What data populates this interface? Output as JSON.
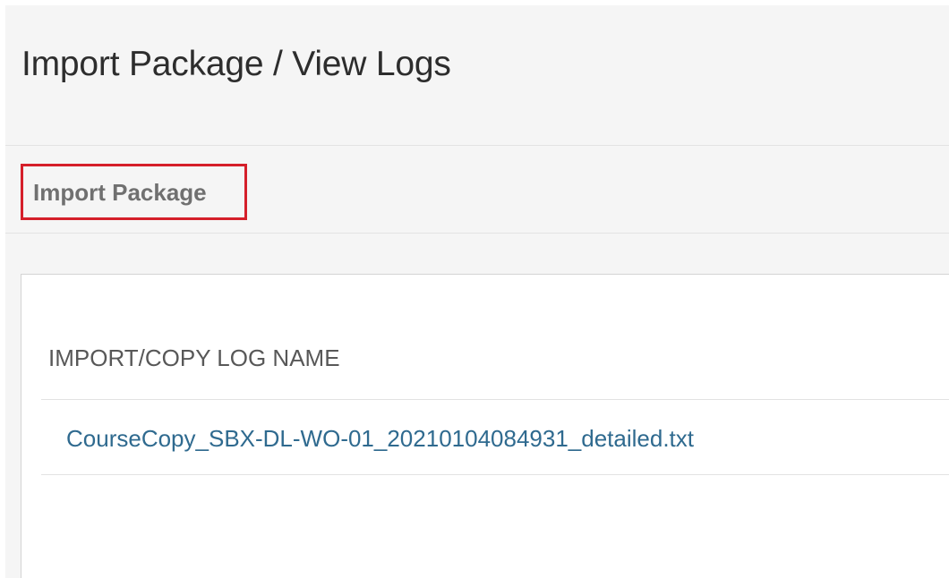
{
  "header": {
    "title": "Import Package / View Logs"
  },
  "actions": {
    "import_package_label": "Import Package"
  },
  "logs_table": {
    "columns": [
      "IMPORT/COPY LOG NAME"
    ],
    "rows": [
      {
        "log_name": "CourseCopy_SBX-DL-WO-01_20210104084931_detailed.txt"
      }
    ]
  },
  "colors": {
    "highlight_border": "#d51f2a",
    "link": "#2f6a8f",
    "page_background": "#f5f5f5"
  }
}
